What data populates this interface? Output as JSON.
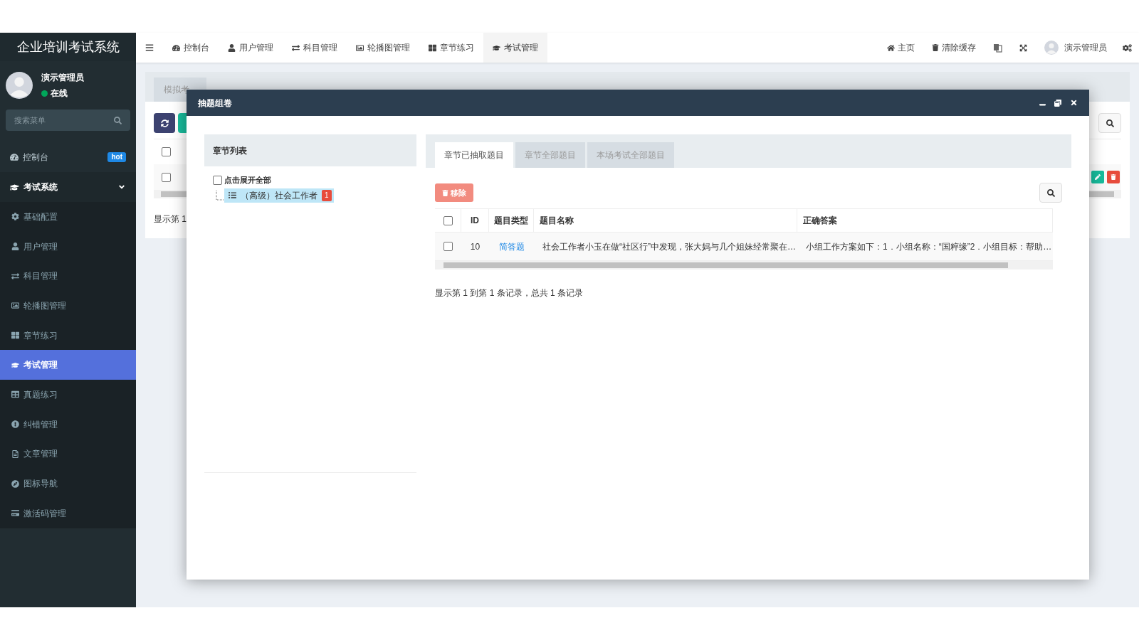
{
  "sidebar": {
    "title": "企业培训考试系统",
    "user": {
      "name": "演示管理员",
      "status": "在线",
      "online": true
    },
    "search": {
      "placeholder": "搜索菜单"
    },
    "items": [
      {
        "label": "控制台",
        "badge": "hot",
        "kind": "link"
      },
      {
        "label": "考试系统",
        "kind": "group",
        "expanded": true,
        "children": [
          {
            "label": "基础配置",
            "selected": false
          },
          {
            "label": "用户管理",
            "selected": false
          },
          {
            "label": "科目管理",
            "selected": false
          },
          {
            "label": "轮播图管理",
            "selected": false
          },
          {
            "label": "章节练习",
            "selected": false
          },
          {
            "label": "考试管理",
            "selected": true
          },
          {
            "label": "真题练习",
            "selected": false
          },
          {
            "label": "纠错管理",
            "selected": false
          },
          {
            "label": "文章管理",
            "selected": false
          },
          {
            "label": "图标导航",
            "selected": false
          },
          {
            "label": "激活码管理",
            "selected": false
          }
        ]
      }
    ]
  },
  "topbar": {
    "nav": [
      {
        "label": "控制台",
        "selected": false
      },
      {
        "label": "用户管理",
        "selected": false
      },
      {
        "label": "科目管理",
        "selected": false
      },
      {
        "label": "轮播图管理",
        "selected": false
      },
      {
        "label": "章节练习",
        "selected": false
      },
      {
        "label": "考试管理",
        "selected": true
      }
    ],
    "home": "主页",
    "clear_cache": "清除缓存",
    "user": "演示管理员"
  },
  "background": {
    "tab": "模拟考",
    "checkboxes": [
      {
        "checked": false
      },
      {
        "checked": false
      }
    ],
    "footer": "显示第 1"
  },
  "modal": {
    "title": "抽题组卷",
    "chapters": {
      "title": "章节列表",
      "expand_all": {
        "label": "点击展开全部",
        "checked": false
      },
      "nodes": [
        {
          "label": "（高级）社会工作者",
          "count": "1",
          "selected": true
        }
      ]
    },
    "tabs": [
      {
        "label": "章节已抽取题目",
        "selected": true
      },
      {
        "label": "章节全部题目",
        "selected": false
      },
      {
        "label": "本场考试全部题目",
        "selected": false
      }
    ],
    "remove_button": "移除",
    "table": {
      "columns": [
        "ID",
        "题目类型",
        "题目名称",
        "正确答案"
      ],
      "header_checked": false,
      "rows": [
        {
          "checked": false,
          "id": "10",
          "type": "简答题",
          "name": "社会工作者小玉在做“社区行”中发现，张大妈与几个姐妹经常聚在…",
          "answer": "小组工作方案如下：1．小组名称：“国粹缘”2．小组目标：帮助…"
        }
      ]
    },
    "footer": "显示第 1 到第 1 条记录，总共 1 条记录"
  }
}
